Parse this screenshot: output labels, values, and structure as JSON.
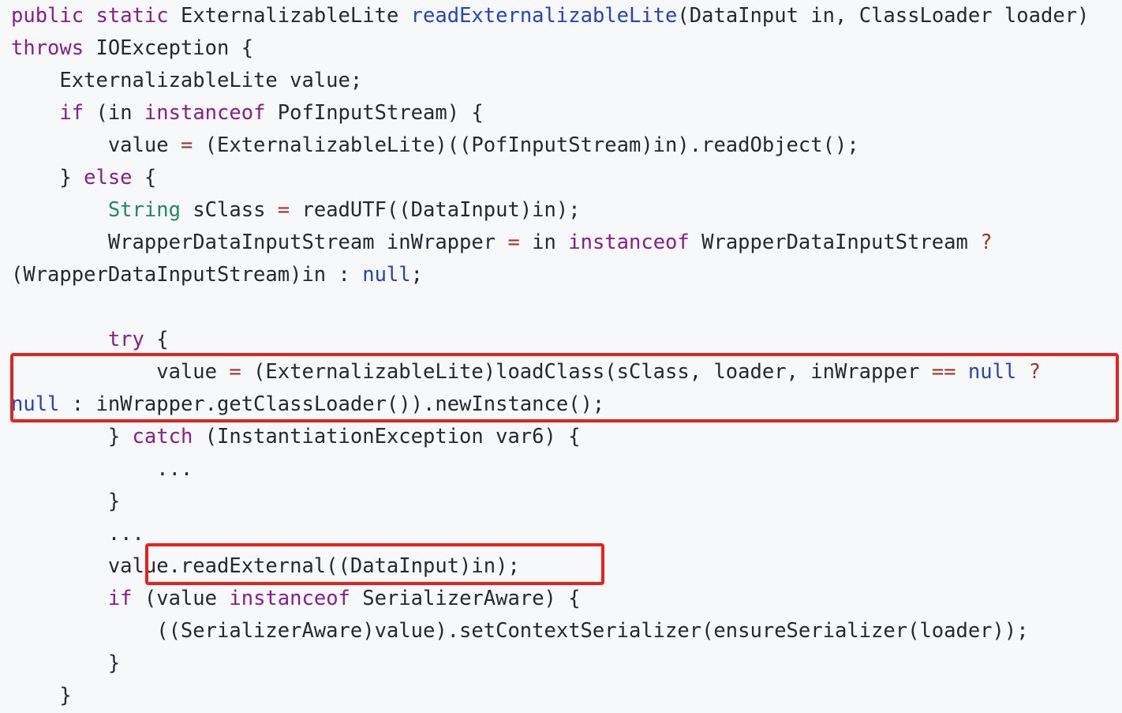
{
  "colors": {
    "background": "#f6f8fa",
    "plain": "#24292e",
    "keyword": "#8b1c8e",
    "function": "#2741c6",
    "type": "#1f8a5b",
    "literal": "#2741c6",
    "operator": "#a3322a",
    "highlight_border": "#e8221b"
  },
  "code": {
    "lines": [
      [
        [
          "kw",
          "public"
        ],
        [
          "p",
          " "
        ],
        [
          "kw",
          "static"
        ],
        [
          "p",
          " ExternalizableLite "
        ],
        [
          "fn",
          "readExternalizableLite"
        ],
        [
          "p",
          "(DataInput in, ClassLoader loader)"
        ]
      ],
      [
        [
          "kw",
          "throws"
        ],
        [
          "p",
          " IOException {"
        ]
      ],
      [
        [
          "p",
          "    ExternalizableLite value;"
        ]
      ],
      [
        [
          "p",
          "    "
        ],
        [
          "kw",
          "if"
        ],
        [
          "p",
          " (in "
        ],
        [
          "kw",
          "instanceof"
        ],
        [
          "p",
          " PofInputStream) {"
        ]
      ],
      [
        [
          "p",
          "        value "
        ],
        [
          "op",
          "="
        ],
        [
          "p",
          " (ExternalizableLite)((PofInputStream)in).readObject();"
        ]
      ],
      [
        [
          "p",
          "    } "
        ],
        [
          "kw",
          "else"
        ],
        [
          "p",
          " {"
        ]
      ],
      [
        [
          "p",
          "        "
        ],
        [
          "type",
          "String"
        ],
        [
          "p",
          " sClass "
        ],
        [
          "op",
          "="
        ],
        [
          "p",
          " readUTF((DataInput)in);"
        ]
      ],
      [
        [
          "p",
          "        WrapperDataInputStream inWrapper "
        ],
        [
          "op",
          "="
        ],
        [
          "p",
          " in "
        ],
        [
          "kw",
          "instanceof"
        ],
        [
          "p",
          " WrapperDataInputStream "
        ],
        [
          "op",
          "?"
        ]
      ],
      [
        [
          "p",
          "(WrapperDataInputStream)in : "
        ],
        [
          "lit",
          "null"
        ],
        [
          "p",
          ";"
        ]
      ],
      [
        [
          "p",
          ""
        ]
      ],
      [
        [
          "p",
          "        "
        ],
        [
          "kw",
          "try"
        ],
        [
          "p",
          " {"
        ]
      ],
      [
        [
          "p",
          "            value "
        ],
        [
          "op",
          "="
        ],
        [
          "p",
          " (ExternalizableLite)loadClass(sClass, loader, inWrapper "
        ],
        [
          "op",
          "=="
        ],
        [
          "p",
          " "
        ],
        [
          "lit",
          "null"
        ],
        [
          "p",
          " "
        ],
        [
          "op",
          "?"
        ]
      ],
      [
        [
          "lit",
          "null"
        ],
        [
          "p",
          " : inWrapper.getClassLoader()).newInstance();"
        ]
      ],
      [
        [
          "p",
          "        } "
        ],
        [
          "kw",
          "catch"
        ],
        [
          "p",
          " (InstantiationException var6) {"
        ]
      ],
      [
        [
          "p",
          "            ..."
        ]
      ],
      [
        [
          "p",
          "        }"
        ]
      ],
      [
        [
          "p",
          "        ..."
        ]
      ],
      [
        [
          "p",
          "        value.readExternal((DataInput)in);"
        ]
      ],
      [
        [
          "p",
          "        "
        ],
        [
          "kw",
          "if"
        ],
        [
          "p",
          " (value "
        ],
        [
          "kw",
          "instanceof"
        ],
        [
          "p",
          " SerializerAware) {"
        ]
      ],
      [
        [
          "p",
          "            ((SerializerAware)value).setContextSerializer(ensureSerializer(loader));"
        ]
      ],
      [
        [
          "p",
          "        }"
        ]
      ],
      [
        [
          "p",
          "    }"
        ]
      ]
    ]
  }
}
